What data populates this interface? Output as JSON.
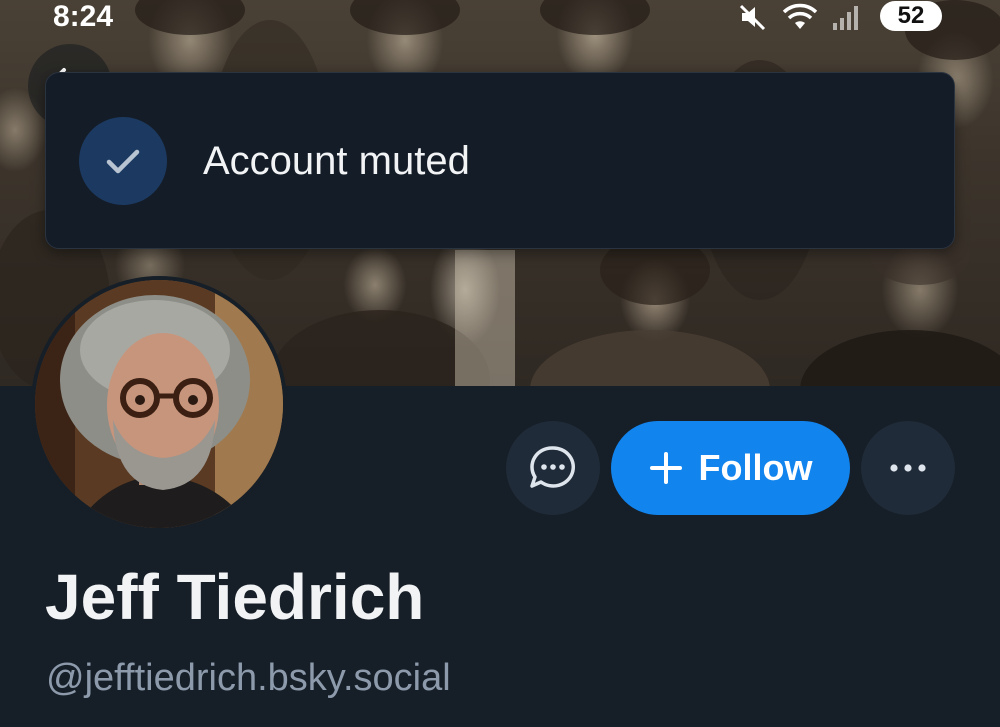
{
  "status_bar": {
    "time": "8:24",
    "battery": "52",
    "icons": [
      "mute-icon",
      "wifi-icon",
      "signal-icon"
    ]
  },
  "toast": {
    "message": "Account muted",
    "icon": "check-icon",
    "icon_bg": "#1c3a61",
    "bg": "#141c27"
  },
  "profile": {
    "display_name": "Jeff Tiedrich",
    "handle": "@jefftiedrich.bsky.social"
  },
  "actions": {
    "follow_label": "Follow",
    "follow_icon": "plus-icon",
    "message_icon": "chat-bubble-icon",
    "more_icon": "ellipsis-icon"
  },
  "colors": {
    "background": "#161e27",
    "accent": "#1184ee",
    "secondary_text": "#8c9aab",
    "button_bg": "#1f2b38"
  }
}
